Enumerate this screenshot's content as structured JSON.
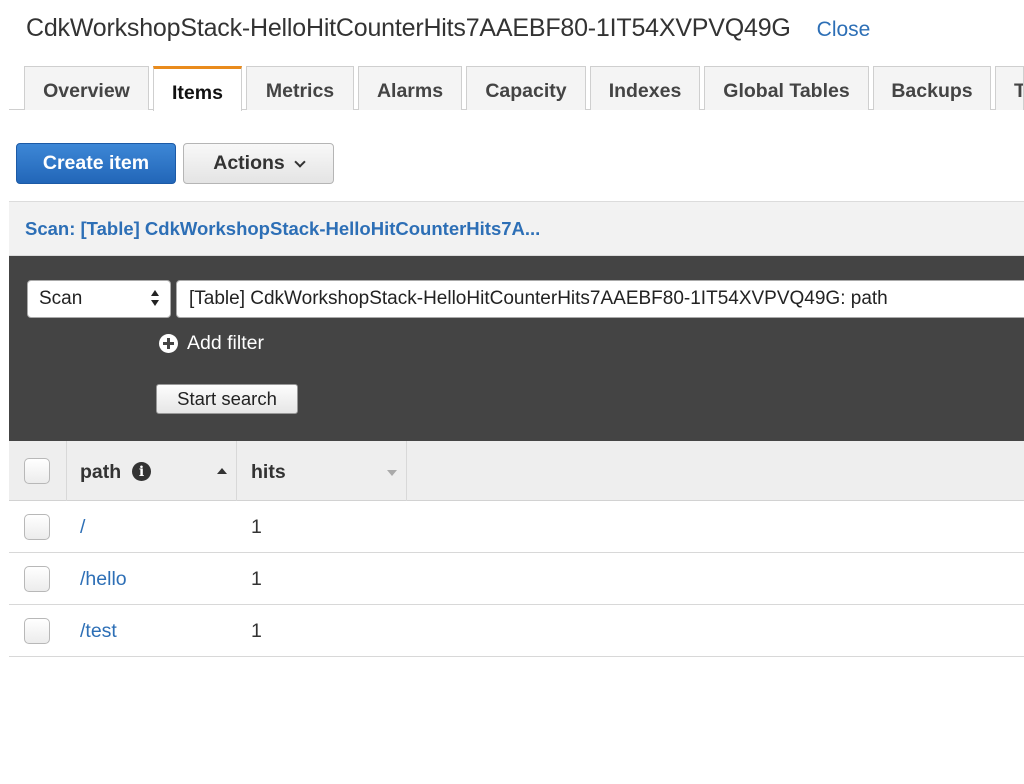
{
  "header": {
    "title": "CdkWorkshopStack-HelloHitCounterHits7AAEBF80-1IT54XVPVQ49G",
    "close_label": "Close"
  },
  "tabs": [
    {
      "label": "Overview",
      "active": false
    },
    {
      "label": "Items",
      "active": true
    },
    {
      "label": "Metrics",
      "active": false
    },
    {
      "label": "Alarms",
      "active": false
    },
    {
      "label": "Capacity",
      "active": false
    },
    {
      "label": "Indexes",
      "active": false
    },
    {
      "label": "Global Tables",
      "active": false
    },
    {
      "label": "Backups",
      "active": false
    },
    {
      "label": "T",
      "active": false
    }
  ],
  "toolbar": {
    "create_label": "Create item",
    "actions_label": "Actions"
  },
  "scan": {
    "header_text": "Scan: [Table] CdkWorkshopStack-HelloHitCounterHits7A...",
    "mode": "Scan",
    "index": "[Table] CdkWorkshopStack-HelloHitCounterHits7AAEBF80-1IT54XVPVQ49G: path",
    "add_filter_label": "Add filter",
    "start_search_label": "Start search"
  },
  "table": {
    "columns": [
      "path",
      "hits"
    ],
    "rows": [
      {
        "path": "/",
        "hits": "1"
      },
      {
        "path": "/hello",
        "hits": "1"
      },
      {
        "path": "/test",
        "hits": "1"
      }
    ]
  },
  "colors": {
    "accent": "#2d6fb6",
    "primary_button": "#2266b8",
    "active_tab": "#e98b1c",
    "filter_panel": "#444444"
  }
}
